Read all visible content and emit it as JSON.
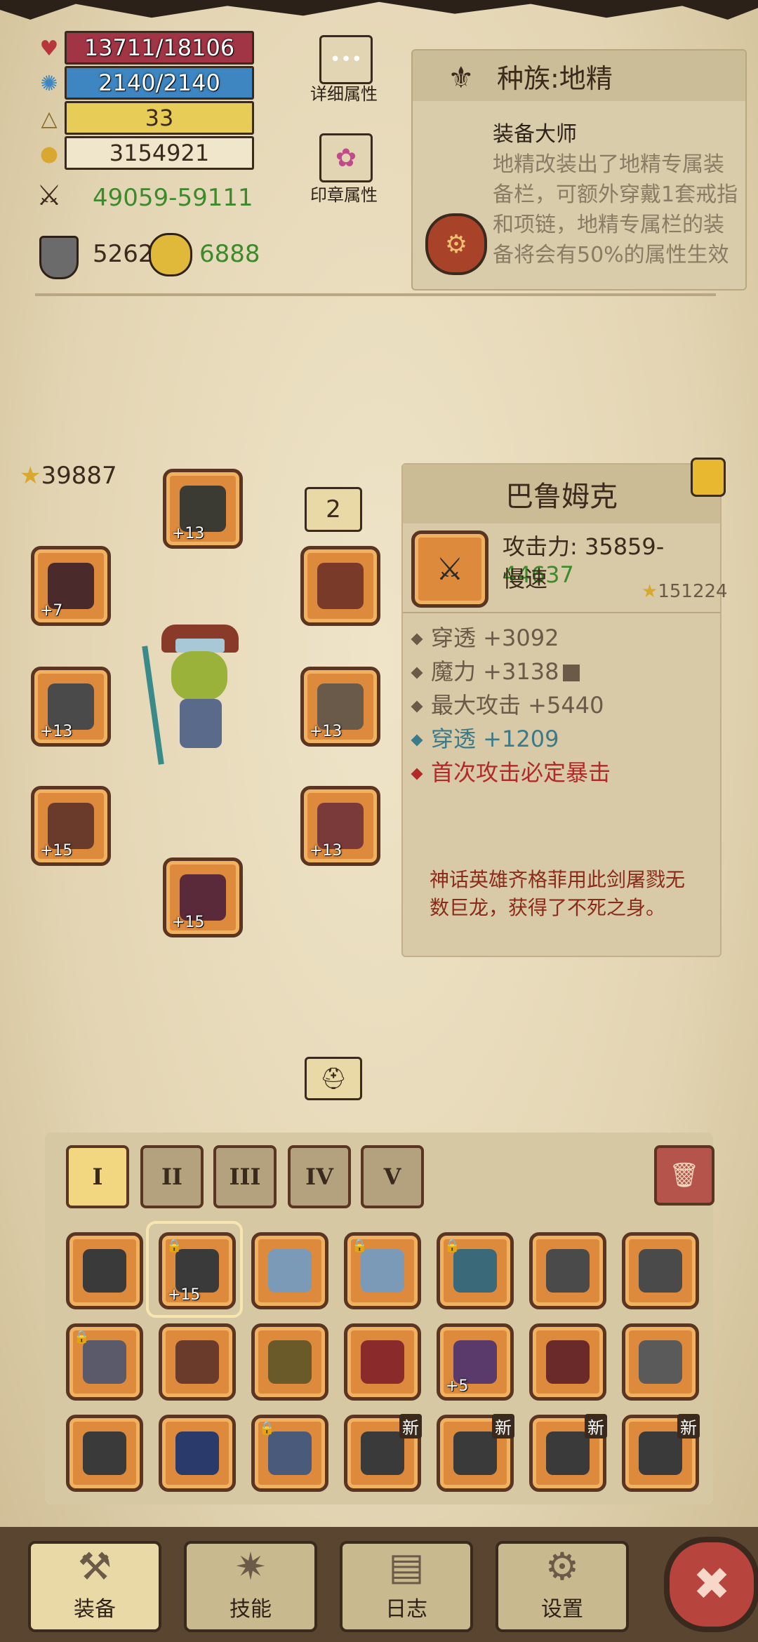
{
  "stats": {
    "hp": "13711/18106",
    "mp": "2140/2140",
    "level": "33",
    "gold": "3154921",
    "attack_min": "49059",
    "attack_sep": "-",
    "attack_max": "59111",
    "armor": "5262",
    "magic": "6888"
  },
  "buttons": {
    "detail_attr": "详细属性",
    "seal_attr": "印章属性"
  },
  "race": {
    "title": "种族:地精",
    "skill_title": "装备大师",
    "skill_desc": "地精改装出了地精专属装备栏，可额外穿戴1套戒指和项链，地精专属栏的装备将会有50%的属性生效（"
  },
  "equipment": {
    "score": "39887",
    "set_number": "2",
    "slots": {
      "helmet": "+13",
      "shoulder": "+7",
      "weapon": "+13",
      "armor": "+13",
      "gloves": "+15",
      "pants": "+13",
      "boots": "+15"
    }
  },
  "item_detail": {
    "name": "巴鲁姆克",
    "attack_label": "攻击力: ",
    "attack_min": "35859",
    "attack_sep": "-",
    "attack_max": "44637",
    "speed": "慢速",
    "score": "151224",
    "attrs": [
      "穿透 +3092",
      "魔力 +3138",
      "最大攻击 +5440"
    ],
    "bonus_attr": "穿透 +1209",
    "special": "首次攻击必定暴击",
    "lore": "神话英雄齐格菲用此剑屠戮无数巨龙，获得了不死之身。"
  },
  "inventory": {
    "tabs": [
      "I",
      "II",
      "III",
      "IV",
      "V"
    ],
    "items": [
      {
        "name": "sword-icon",
        "plus": "",
        "lock": false,
        "new": false
      },
      {
        "name": "sword-icon",
        "plus": "+15",
        "lock": true,
        "new": false
      },
      {
        "name": "winged-ring-icon",
        "plus": "",
        "lock": false,
        "new": false
      },
      {
        "name": "winged-ring-icon",
        "plus": "",
        "lock": true,
        "new": false
      },
      {
        "name": "staff-icon",
        "plus": "",
        "lock": true,
        "new": false
      },
      {
        "name": "spiked-mace-icon",
        "plus": "",
        "lock": false,
        "new": false
      },
      {
        "name": "spiked-mace-icon",
        "plus": "",
        "lock": false,
        "new": false
      },
      {
        "name": "dagger-icon",
        "plus": "",
        "lock": true,
        "new": false
      },
      {
        "name": "plague-mask-icon",
        "plus": "",
        "lock": false,
        "new": false
      },
      {
        "name": "crown-helm-icon",
        "plus": "",
        "lock": false,
        "new": false
      },
      {
        "name": "red-crown-icon",
        "plus": "",
        "lock": false,
        "new": false
      },
      {
        "name": "purple-helm-icon",
        "plus": "+5",
        "lock": false,
        "new": false
      },
      {
        "name": "red-hood-icon",
        "plus": "",
        "lock": false,
        "new": false
      },
      {
        "name": "horned-helm-icon",
        "plus": "",
        "lock": false,
        "new": false
      },
      {
        "name": "dark-helm-icon",
        "plus": "",
        "lock": false,
        "new": false
      },
      {
        "name": "blue-helm-icon",
        "plus": "",
        "lock": false,
        "new": false
      },
      {
        "name": "winged-crown-icon",
        "plus": "",
        "lock": true,
        "new": false
      },
      {
        "name": "unknown-armor-icon",
        "plus": "",
        "lock": false,
        "new": true
      },
      {
        "name": "unknown-armor-icon",
        "plus": "",
        "lock": false,
        "new": true
      },
      {
        "name": "unknown-armor-icon",
        "plus": "",
        "lock": false,
        "new": true
      },
      {
        "name": "unknown-armor-icon",
        "plus": "",
        "lock": false,
        "new": true
      }
    ],
    "new_label": "新"
  },
  "nav": {
    "equip": "装备",
    "skill": "技能",
    "log": "日志",
    "settings": "设置"
  }
}
